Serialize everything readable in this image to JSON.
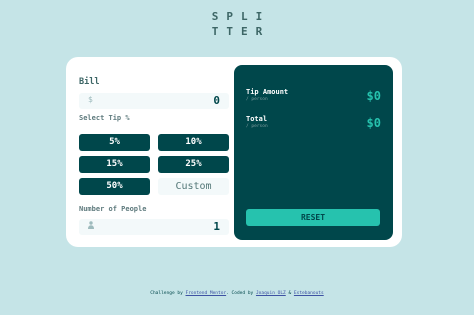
{
  "header": {
    "logo_line1": "SPLI",
    "logo_line2": "TTER"
  },
  "bill": {
    "label": "Bill",
    "currency_icon": "dollar-icon",
    "value": "0"
  },
  "tip": {
    "label": "Select Tip %",
    "options": [
      "5%",
      "10%",
      "15%",
      "25%",
      "50%"
    ],
    "custom_placeholder": "Custom"
  },
  "people": {
    "label": "Number of People",
    "person_icon": "person-icon",
    "value": "1"
  },
  "results": {
    "tip_label": "Tip Amount",
    "tip_sub": "/ person",
    "tip_value": "$0",
    "total_label": "Total",
    "total_sub": "/ person",
    "total_value": "$0",
    "reset_label": "RESET"
  },
  "footer": {
    "prefix": "Challenge by ",
    "link1": "Frontend Mentor",
    "middle": ". Coded by ",
    "link2": "Joaquin OLZ",
    "amp": " & ",
    "link3": "Estebanouts"
  },
  "colors": {
    "background": "#c5e4e7",
    "dark_cyan": "#00474b",
    "accent": "#26c2ae",
    "light_field": "#f3f9fa"
  }
}
